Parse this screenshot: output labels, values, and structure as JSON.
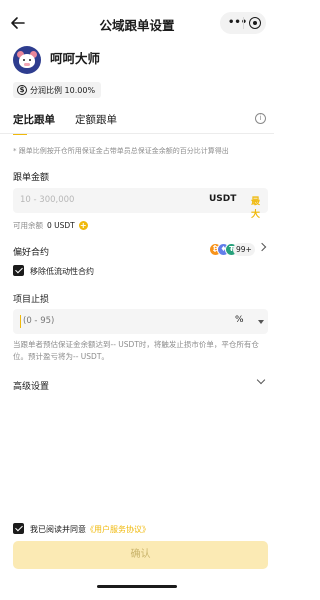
{
  "header": {
    "title": "公域跟单设置",
    "more_icon": "more-dots",
    "target_icon": "target-icon"
  },
  "profile": {
    "name": "呵呵大师",
    "badge": "分润比例 10.00%"
  },
  "tabs": [
    {
      "label": "定比跟单",
      "active": true
    },
    {
      "label": "定额跟单",
      "active": false
    }
  ],
  "note": "* 跟单比例按开仓所用保证金占带单员总保证金余额的百分比计算得出",
  "amount": {
    "label": "跟单金额",
    "placeholder": "10 - 300,000",
    "unit": "USDT",
    "max": "最大"
  },
  "available": {
    "label": "可用余额",
    "value": "0 USDT"
  },
  "preferred": {
    "label": "偏好合约",
    "count": "99+"
  },
  "remove_low_liquidity": {
    "label": "移除低流动性合约",
    "checked": true
  },
  "stop_loss": {
    "label": "项目止损",
    "placeholder": "(0 - 95)",
    "unit": "%"
  },
  "stop_loss_desc": "当跟单者预估保证金余额达到-- USDT时，将触发止损市价单，平仓所有仓位。预计盈亏将为-- USDT。",
  "advanced": {
    "label": "高级设置"
  },
  "agreement": {
    "prefix": "我已阅读并同意",
    "link": "《用户服务协议》",
    "checked": true
  },
  "confirm": {
    "label": "确认",
    "enabled": false
  },
  "colors": {
    "accent": "#F0B90B",
    "disabled_button": "#FBEAB4"
  }
}
